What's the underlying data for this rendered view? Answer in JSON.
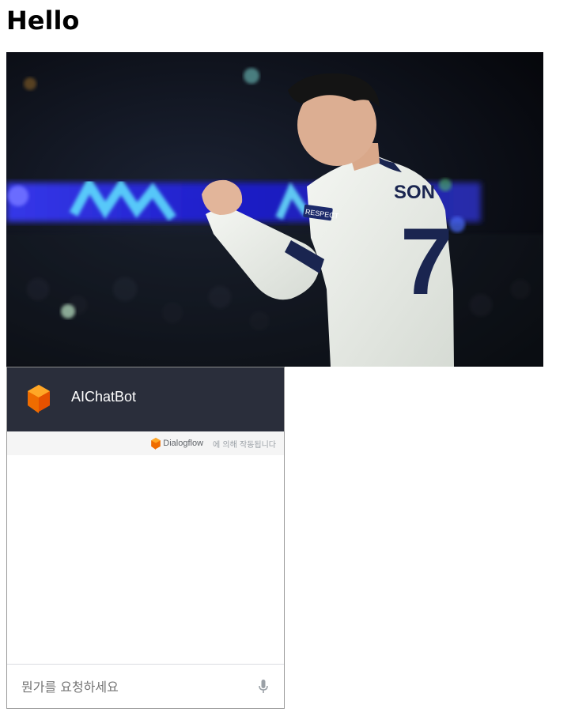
{
  "page": {
    "title": "Hello"
  },
  "photo": {
    "jersey_name": "SON",
    "jersey_number": "7",
    "sleeve_badge": "RESPECT"
  },
  "chatbot": {
    "agent_name": "AIChatBot",
    "powered_by_brand": "Dialogflow",
    "powered_by_text": "에 의해 작동됩니다",
    "input_placeholder": "뭔가를 요청하세요",
    "colors": {
      "header_bg": "#2a2e3b",
      "accent": "#ef6c00",
      "powered_bg": "#f5f5f5"
    }
  }
}
